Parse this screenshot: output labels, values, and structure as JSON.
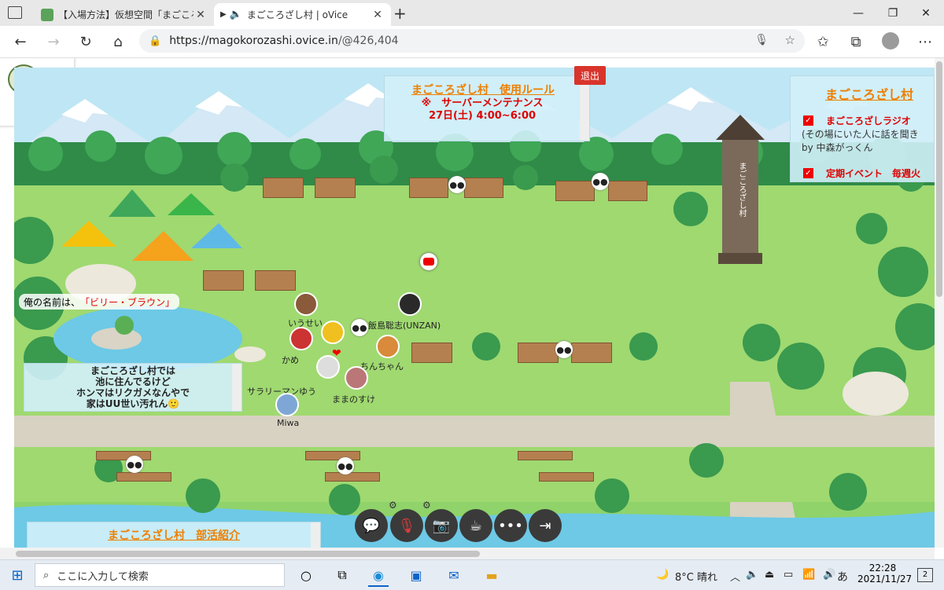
{
  "browser": {
    "tabs": [
      {
        "title": "【入場方法】仮想空間「まごころざし村」",
        "active": false,
        "favicon_color": "#5ba35b"
      },
      {
        "title": "まごころざし村 | oVice",
        "active": true,
        "favicon_color": "#555555"
      }
    ],
    "new_tab": "+",
    "url_host": "https://magokorozashi.ovice.in",
    "url_path": "/@426,404"
  },
  "map": {
    "exit_button": "退出",
    "rules_panel": {
      "title": "まごころざし村　使用ルール",
      "line1": "※　サーバーメンテナンス",
      "line2": "27日(土) 4:00~6:00"
    },
    "right_panel": {
      "title": "まごころざし村",
      "radio_label": "まごころざしラジオ",
      "radio_desc": "(その場にいた人に話を聞き",
      "radio_by": "by 中森がっくん",
      "event_label": "定期イベント　毎週火"
    },
    "name_sign": {
      "prefix": "俺の名前は、",
      "name": "「ビリー・ブラウン」"
    },
    "turtle_note": {
      "line1": "まごころざし村では",
      "line2": "池に住んでるけど",
      "line3": "ホンマはリクガメなんやで",
      "line4": "家はUU世い汚れん🙂"
    },
    "club_panel": {
      "title": "まごころざし村　部活紹介"
    },
    "tower_label": "まごころざし村",
    "users": [
      {
        "name": "いうせい"
      },
      {
        "name": "飯島聡志(UNZAN)"
      },
      {
        "name": "かめ"
      },
      {
        "name": "ちんちゃん"
      },
      {
        "name": "サラリーマンゆう"
      },
      {
        "name": "ままのすけ"
      },
      {
        "name": "Miwa"
      }
    ]
  },
  "controls": [
    "chat",
    "mic-off",
    "camera-off",
    "coffee",
    "more",
    "exit"
  ],
  "taskbar": {
    "search_placeholder": "ここに入力して検索",
    "weather": "8°C  晴れ",
    "ime": "あ",
    "time": "22:28",
    "date": "2021/11/27",
    "notifications": "2"
  }
}
